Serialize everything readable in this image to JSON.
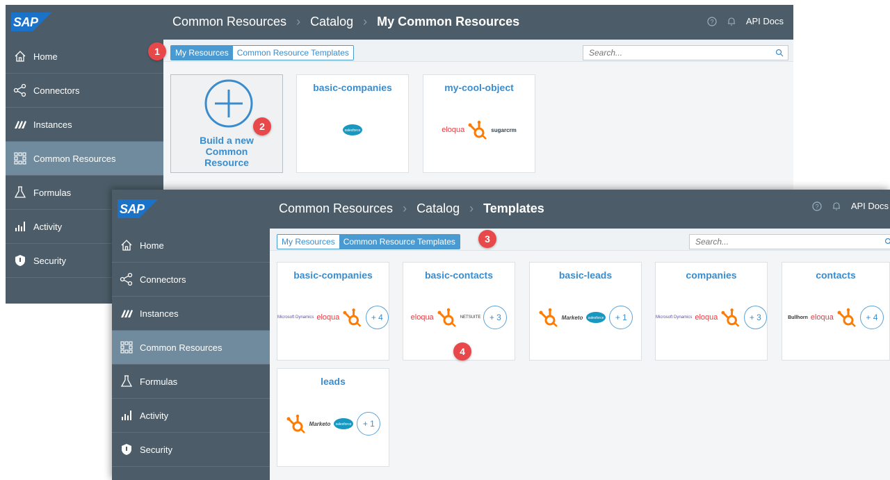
{
  "colors": {
    "topbar": "#4c5d69",
    "sidebar": "#4c5d69",
    "sidebar_active": "#6f8b9d",
    "accent": "#3a8ccd",
    "step_badge": "#e8484a",
    "hubspot": "#ff7a00",
    "salesforce": "#1798c1",
    "eloqua": "#e23c42"
  },
  "brand": "SAP",
  "nav_items": [
    {
      "label": "Home",
      "icon": "home-icon"
    },
    {
      "label": "Connectors",
      "icon": "connectors-icon"
    },
    {
      "label": "Instances",
      "icon": "instances-icon"
    },
    {
      "label": "Common Resources",
      "icon": "common-resources-icon"
    },
    {
      "label": "Formulas",
      "icon": "formulas-icon"
    },
    {
      "label": "Activity",
      "icon": "activity-icon"
    },
    {
      "label": "Security",
      "icon": "security-icon"
    }
  ],
  "topbar_right": {
    "help_icon": "help-icon",
    "bell_icon": "bell-icon",
    "api_docs": "API Docs"
  },
  "window1": {
    "breadcrumb": [
      "Common Resources",
      "Catalog",
      "My Common Resources"
    ],
    "active_nav": "Common Resources",
    "tabs": [
      "My Resources",
      "Common Resource Templates"
    ],
    "selected_tab": "My Resources",
    "search_placeholder": "Search...",
    "build_card": {
      "label_lines": [
        "Build a new",
        "Common",
        "Resource"
      ]
    },
    "cards": [
      {
        "title": "basic-companies",
        "logos": [
          "salesforce"
        ]
      },
      {
        "title": "my-cool-object",
        "logos": [
          "eloqua",
          "hubspot",
          "sugarcrm"
        ]
      }
    ]
  },
  "window2": {
    "breadcrumb": [
      "Common Resources",
      "Catalog",
      "Templates"
    ],
    "active_nav": "Common Resources",
    "tabs": [
      "My Resources",
      "Common Resource Templates"
    ],
    "selected_tab": "Common Resource Templates",
    "search_placeholder": "Search...",
    "cards": [
      {
        "title": "basic-companies",
        "logos": [
          "microsoft-dynamics",
          "eloqua",
          "hubspot"
        ],
        "more": "+ 4"
      },
      {
        "title": "basic-contacts",
        "logos": [
          "eloqua",
          "hubspot",
          "netsuite"
        ],
        "more": "+ 3"
      },
      {
        "title": "basic-leads",
        "logos": [
          "hubspot",
          "marketo",
          "salesforce"
        ],
        "more": "+ 1"
      },
      {
        "title": "companies",
        "logos": [
          "microsoft-dynamics",
          "eloqua",
          "hubspot"
        ],
        "more": "+ 3"
      },
      {
        "title": "contacts",
        "logos": [
          "bullhorn",
          "eloqua",
          "hubspot"
        ],
        "more": "+ 4"
      },
      {
        "title": "leads",
        "logos": [
          "hubspot",
          "marketo",
          "salesforce"
        ],
        "more": "+ 1"
      }
    ]
  },
  "logo_texts": {
    "eloqua": "eloqua",
    "sugarcrm": "sugarcrm",
    "marketo": "Marketo",
    "bullhorn": "Bullhorn",
    "salesforce": "salesforce",
    "microsoft-dynamics": "Microsoft Dynamics",
    "netsuite": "NETSUITE"
  },
  "steps": [
    "1",
    "2",
    "3",
    "4"
  ]
}
